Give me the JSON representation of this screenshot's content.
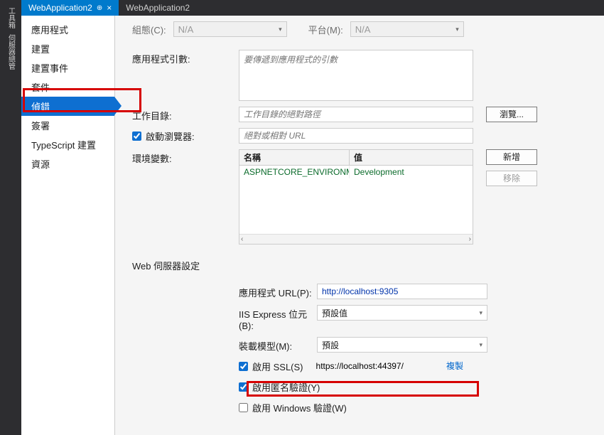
{
  "leftbar": {
    "tools": "工具箱",
    "server": "伺服器總管"
  },
  "tabs": [
    {
      "label": "WebApplication2",
      "active": true,
      "pinned": true,
      "closable": true
    },
    {
      "label": "WebApplication2",
      "active": false
    }
  ],
  "nav": {
    "items": [
      {
        "key": "app",
        "label": "應用程式"
      },
      {
        "key": "build",
        "label": "建置"
      },
      {
        "key": "buildevents",
        "label": "建置事件"
      },
      {
        "key": "package",
        "label": "套件"
      },
      {
        "key": "debug",
        "label": "偵錯",
        "selected": true
      },
      {
        "key": "sign",
        "label": "簽署"
      },
      {
        "key": "ts",
        "label": "TypeScript 建置"
      },
      {
        "key": "resources",
        "label": "資源"
      }
    ]
  },
  "top": {
    "config_label": "組態(C):",
    "config_value": "N/A",
    "platform_label": "平台(M):",
    "platform_value": "N/A"
  },
  "form": {
    "args_label": "應用程式引數:",
    "args_placeholder": "要傳遞到應用程式的引數",
    "workdir_label": "工作目錄:",
    "workdir_placeholder": "工作目錄的絕對路徑",
    "browse": "瀏覽...",
    "launch_browser_label": "啟動瀏覽器:",
    "launch_browser_placeholder": "絕對或相對 URL",
    "env_label": "環境變數:",
    "env_cols": {
      "name": "名稱",
      "value": "值"
    },
    "env_rows": [
      {
        "name": "ASPNETCORE_ENVIRONMENT",
        "value": "Development"
      }
    ],
    "add": "新增",
    "remove": "移除",
    "scroll_left": "‹",
    "scroll_right": "›"
  },
  "web": {
    "section": "Web 伺服器設定",
    "url_label": "應用程式 URL(P):",
    "url_value": "http://localhost:9305",
    "iis_label": "IIS Express 位元(B):",
    "iis_value": "預設值",
    "host_label": "裝載模型(M):",
    "host_value": "預設",
    "ssl_label": "啟用 SSL(S)",
    "ssl_url": "https://localhost:44397/",
    "copy": "複製",
    "anon_label": "啟用匿名驗證(Y)",
    "win_label": "啟用 Windows 驗證(W)"
  }
}
